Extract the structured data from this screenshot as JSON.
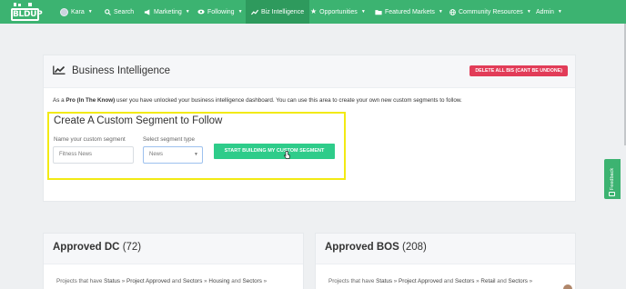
{
  "app": {
    "logo_text": "BLDUP"
  },
  "nav": {
    "items": [
      {
        "label": "Kara",
        "icon": "user-avatar",
        "caret": true
      },
      {
        "label": "Search",
        "icon": "search-icon",
        "caret": false
      },
      {
        "label": "Marketing",
        "icon": "megaphone-icon",
        "caret": true
      },
      {
        "label": "Following",
        "icon": "eye-icon",
        "caret": true
      },
      {
        "label": "Biz Intelligence",
        "icon": "trend-icon",
        "caret": false,
        "active": true
      },
      {
        "label": "Opportunities",
        "icon": "star-icon",
        "caret": true
      },
      {
        "label": "Featured Markets",
        "icon": "folder-icon",
        "caret": true
      },
      {
        "label": "Community Resources",
        "icon": "globe-icon",
        "caret": true
      },
      {
        "label": "Admin",
        "icon": "",
        "caret": true
      }
    ]
  },
  "bi": {
    "title": "Business Intelligence",
    "delete_button": "DELETE ALL BIS (CANT BE UNDONE)",
    "intro_prefix": "As a",
    "intro_plan": "Pro (In The Know)",
    "intro_suffix": "user you have unlocked your business intelligence dashboard. You can use this area to create your own new custom segments to follow."
  },
  "segment": {
    "title": "Create A Custom Segment to Follow",
    "name_label": "Name your custom segment",
    "name_value": "Fitness News",
    "type_label": "Select segment type",
    "type_value": "News",
    "button": "START BUILDING MY CUSTOM SEGMENT"
  },
  "cards": [
    {
      "title": "Approved DC",
      "count": "(72)",
      "text_start": "Projects that have",
      "t1": "Status",
      "t2": "Project Approved",
      "and1": "and",
      "t3": "Sectors",
      "t4": "Housing",
      "and2": "and",
      "t5": "Sectors"
    },
    {
      "title": "Approved BOS",
      "count": "(208)",
      "text_start": "Projects that have",
      "t1": "Status",
      "t2": "Project Approved",
      "and1": "and",
      "t3": "Sectors",
      "t4": "Retail",
      "and2": "and",
      "t5": "Sectors"
    }
  ],
  "feedback_label": "Feedback",
  "colors": {
    "nav": "#3cb371",
    "accent_button": "#2ecc8a",
    "danger": "#e23c58",
    "highlight": "#f2ea14"
  }
}
